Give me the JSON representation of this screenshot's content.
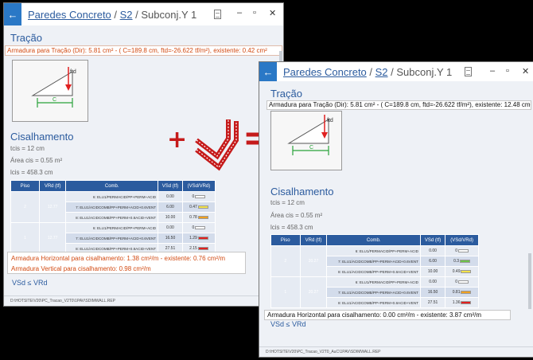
{
  "win1": {
    "title_link": "Paredes Concreto",
    "title_sep1": " / ",
    "title_s2": "S2",
    "title_sep2": " / ",
    "title_sub": "Subconj.Y 1",
    "ctrl_min": "–",
    "ctrl_max": "▫",
    "ctrl_close": "✕",
    "section_tracao": "Tração",
    "tracao_line": "Armadura para Tração (Dir): 5.81 cm² - ( C=189.8 cm, ftd=-26.622 tf/m²),  existente: 0.42 cm²",
    "fig_ftd": "ftd",
    "fig_c": "C",
    "section_cis": "Cisalhamento",
    "t_cis": "tcis = 12 cm",
    "area_cis": "Área cis = 0.55 m²",
    "l_cis": "lcis = 458.3 cm",
    "table": {
      "headers": [
        "Piso",
        "VRd (tf)",
        "Comb.",
        "VSd (tf)",
        "(VSd/VRd)"
      ],
      "groups": [
        {
          "piso": "2",
          "vrd": "12.77",
          "rows": [
            {
              "comb": "6: ELU1/PERMACID/PP+PERM+ACID",
              "vsd": "0.00",
              "ratio": "0",
              "color": "#ffffff"
            },
            {
              "comb": "7: ELU1/ACIDCOMB/PP+PERM+ACID+0.6VENT",
              "vsd": "6.00",
              "ratio": "0.47",
              "color": "#f3e24a"
            },
            {
              "comb": "8: ELU1/ACIDCOMB/PP+PERM+0.8ACID+VENT",
              "vsd": "10.00",
              "ratio": "0.78",
              "color": "#f0a020"
            }
          ]
        },
        {
          "piso": "1",
          "vrd": "12.77",
          "rows": [
            {
              "comb": "6: ELU1/PERMACID/PP+PERM+ACID",
              "vsd": "0.00",
              "ratio": "0",
              "color": "#ffffff"
            },
            {
              "comb": "7: ELU1/ACIDCOMB/PP+PERM+ACID+0.6VENT",
              "vsd": "16.50",
              "ratio": "1.29",
              "color": "#e02020"
            },
            {
              "comb": "8: ELU1/ACIDCOMB/PP+PERM+0.8ACID+VENT",
              "vsd": "27.51",
              "ratio": "2.15",
              "color": "#e02020"
            }
          ]
        }
      ]
    },
    "overlay_h": "Armadura Horizontal para cisalhamento: 1.38 cm²/m - existente: 0.76 cm²/m",
    "overlay_v": "Armadura Vertical para cisalhamento: 0.98 cm²/m",
    "vsd_label": "VSd ≤ VRd",
    "status": "D:\\HOTSITE\\V20\\PC_Tracao_V2T0\\1PAV\\SDIMWALL.REP"
  },
  "win2": {
    "title_link": "Paredes Concreto",
    "title_sep1": " / ",
    "title_s2": "S2",
    "title_sep2": " / ",
    "title_sub": "Subconj.Y 1",
    "ctrl_min": "–",
    "ctrl_max": "▫",
    "ctrl_close": "✕",
    "section_tracao": "Tração",
    "tracao_line": "Armadura para Tração (Dir): 5.81 cm² - ( C=189.8 cm, ftd=-26.622 tf/m²),  existente: 12.48 cm²",
    "fig_ftd": "ftd",
    "fig_c": "C",
    "section_cis": "Cisalhamento",
    "t_cis": "tcis = 12 cm",
    "area_cis": "Área cis = 0.55 m²",
    "l_cis": "lcis = 458.3 cm",
    "table": {
      "headers": [
        "Piso",
        "VRd (tf)",
        "Comb.",
        "VSd (tf)",
        "(VSd/VRd)"
      ],
      "groups": [
        {
          "piso": "2",
          "vrd": "20.27",
          "rows": [
            {
              "comb": "6: ELU1/PERMACID/PP+PERM+ACID",
              "vsd": "0.00",
              "ratio": "0",
              "color": "#ffffff"
            },
            {
              "comb": "7: ELU1/ACIDCOMB/PP+PERM+ACID+0.6VENT",
              "vsd": "6.00",
              "ratio": "0.3",
              "color": "#6cc24a"
            },
            {
              "comb": "8: ELU1/ACIDCOMB/PP+PERM+0.8ACID+VENT",
              "vsd": "10.00",
              "ratio": "0.49",
              "color": "#f3e24a"
            }
          ]
        },
        {
          "piso": "1",
          "vrd": "20.27",
          "rows": [
            {
              "comb": "6: ELU1/PERMACID/PP+PERM+ACID",
              "vsd": "0.00",
              "ratio": "0",
              "color": "#ffffff"
            },
            {
              "comb": "7: ELU1/ACIDCOMB/PP+PERM+ACID+0.6VENT",
              "vsd": "16.50",
              "ratio": "0.81",
              "color": "#f0a020"
            },
            {
              "comb": "8: ELU1/ACIDCOMB/PP+PERM+0.8ACID+VENT",
              "vsd": "27.51",
              "ratio": "1.36",
              "color": "#e02020"
            }
          ]
        }
      ]
    },
    "overlay_h": "Armadura Horizontal para cisalhamento: 0.00 cm²/m - existente: 3.87 cm²/m",
    "vsd_label": "VSd ≤ VRd",
    "status": "D:\\HOTSITE\\V20\\PC_Tracao_V2T0_AuC\\1PAV\\SDIMWALL.REP"
  },
  "operators": {
    "plus": "+",
    "equals": "="
  },
  "colors": {
    "accent": "#2b5b9e",
    "titlebar_back": "#2a78c6",
    "warning_text": "#d24a12",
    "operator": "#c51a1a"
  }
}
